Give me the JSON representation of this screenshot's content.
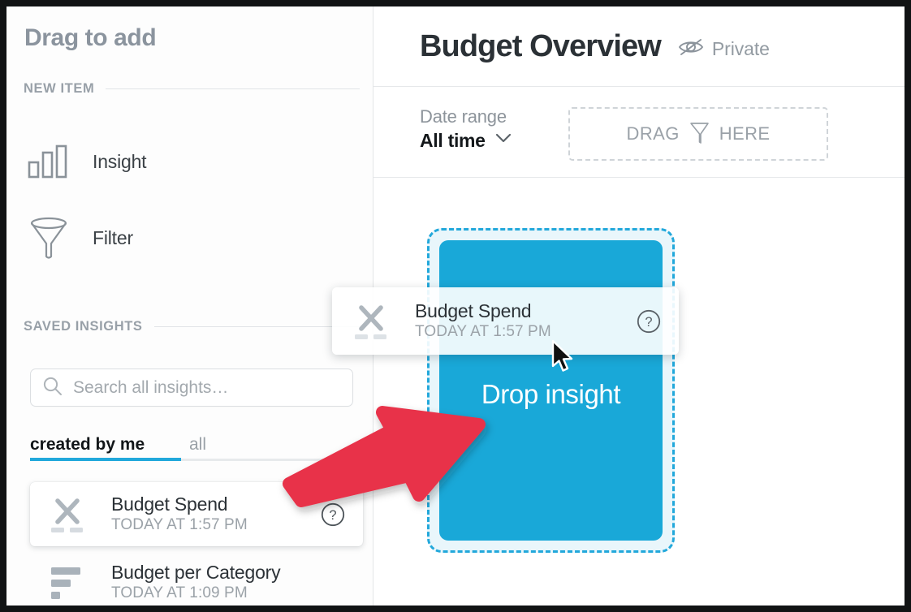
{
  "sidebar": {
    "heading": "Drag to add",
    "sections": {
      "new_item": "NEW ITEM",
      "saved_insights": "SAVED INSIGHTS"
    },
    "new_items": [
      {
        "label": "Insight",
        "icon": "bar-chart-icon"
      },
      {
        "label": "Filter",
        "icon": "funnel-icon"
      }
    ],
    "search": {
      "placeholder": "Search all insights…",
      "value": "",
      "icon": "search-icon"
    },
    "tabs": [
      {
        "label": "created by me",
        "active": true
      },
      {
        "label": "all",
        "active": false
      }
    ],
    "saved_insights": [
      {
        "title": "Budget Spend",
        "subtitle": "TODAY AT 1:57 PM",
        "icon": "scatter-plot-icon",
        "help_icon": "question-mark-circle-icon",
        "selected": true
      },
      {
        "title": "Budget per Category",
        "subtitle": "TODAY AT 1:09 PM",
        "icon": "horizontal-bar-chart-icon",
        "selected": false
      }
    ]
  },
  "main": {
    "title": "Budget Overview",
    "privacy": {
      "label": "Private",
      "icon": "eye-off-icon"
    },
    "date_range": {
      "label": "Date range",
      "value": "All time",
      "chevron": "chevron-down-icon"
    },
    "filter_dropzone": {
      "word_before": "DRAG",
      "word_after": "HERE",
      "icon": "funnel-icon"
    },
    "drop_target": {
      "label": "Drop insight"
    }
  },
  "drag_ghost": {
    "title": "Budget Spend",
    "subtitle": "TODAY AT 1:57 PM",
    "icon": "scatter-plot-icon",
    "help_icon": "question-mark-circle-icon"
  },
  "annotation": {
    "type": "red-arrow",
    "color": "#E8334A"
  },
  "cursor": {
    "type": "arrow-pointer"
  },
  "colors": {
    "accent_blue": "#21A8DB",
    "drop_card_blue": "#19A8D8",
    "drop_zone_bg": "#E9F6FB",
    "annotation_red": "#E8334A",
    "text_dark": "#2B3136",
    "text_muted": "#9AA1A8"
  }
}
